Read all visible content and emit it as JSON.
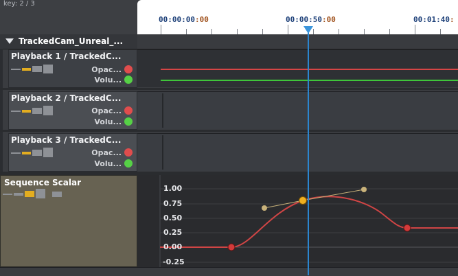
{
  "key": {
    "label": "key: 2 / 3"
  },
  "ruler": {
    "times": [
      {
        "hms": "00:00:00",
        "frames": ":00"
      },
      {
        "hms": "00:00:50",
        "frames": ":00"
      },
      {
        "hms": "00:01:40",
        "frames": ":"
      }
    ]
  },
  "group": {
    "title": "TrackedCam_Unreal_..."
  },
  "tracks": [
    {
      "title": "Playback 1 / TrackedC...",
      "opacity_label": "Opac...",
      "volume_label": "Volu..."
    },
    {
      "title": "Playback 2 / TrackedC...",
      "opacity_label": "Opac...",
      "volume_label": "Volu..."
    },
    {
      "title": "Playback 3 / TrackedC...",
      "opacity_label": "Opac...",
      "volume_label": "Volu..."
    }
  ],
  "scalar": {
    "title": "Sequence Scalar",
    "y_ticks": [
      "1.00",
      "0.75",
      "0.50",
      "0.25",
      "0.00",
      "-0.25"
    ]
  },
  "colors": {
    "playhead": "#2b86d0",
    "curve": "#d04545",
    "keyframe": "#d33a3a",
    "selected_key": "#f0b020",
    "tangent": "#c9b27a",
    "opacity_dot": "#e04d4d",
    "volume_dot": "#56d146"
  }
}
